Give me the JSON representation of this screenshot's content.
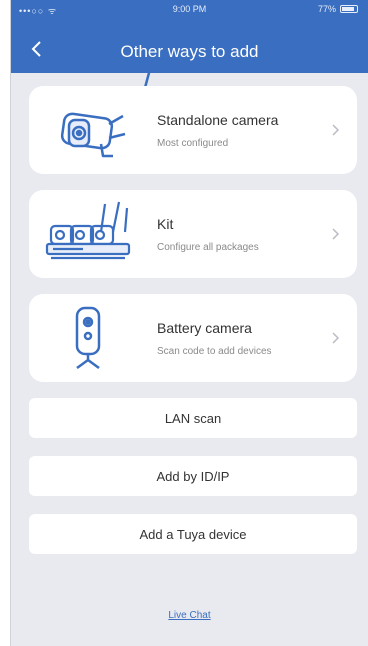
{
  "status_bar": {
    "signal": "•••○○ ᯤ",
    "time": "9:00 PM",
    "battery": "77%"
  },
  "header": {
    "title": "Other ways to add"
  },
  "options": [
    {
      "title": "Standalone camera",
      "subtitle": "Most configured",
      "icon": "bullet-camera-icon"
    },
    {
      "title": "Kit",
      "subtitle": "Configure all packages",
      "icon": "nvr-kit-icon"
    },
    {
      "title": "Battery camera",
      "subtitle": "Scan code to add devices",
      "icon": "battery-camera-icon"
    }
  ],
  "buttons": {
    "lan_scan": "LAN scan",
    "add_by_id": "Add by ID/IP",
    "add_tuya": "Add a Tuya device"
  },
  "footer": {
    "live_chat": "Live Chat"
  },
  "colors": {
    "header": "#3a6ec0",
    "background": "#e9eaef",
    "card": "#ffffff",
    "icon": "#3a6ec0"
  }
}
